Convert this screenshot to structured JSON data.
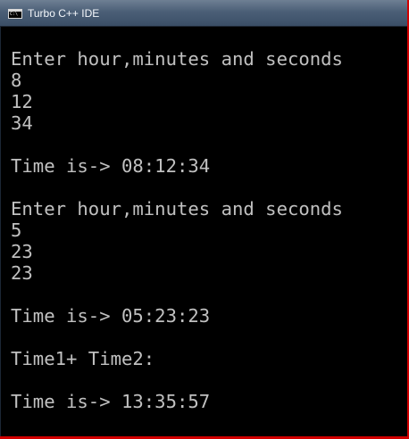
{
  "window": {
    "title": "Turbo C++ IDE",
    "app_icon": "console-icon",
    "app_icon_text": "C:\\",
    "background": "#000000",
    "foreground": "#C0C0C0",
    "frame_color": "#D10000"
  },
  "console": {
    "lines": [
      "Enter hour,minutes and seconds",
      "8",
      "12",
      "34",
      "Time is-> 08:12:34",
      "Enter hour,minutes and seconds",
      "5",
      "23",
      "23",
      "Time is-> 05:23:23",
      "Time1+ Time2:",
      "Time is-> 13:35:57"
    ]
  }
}
